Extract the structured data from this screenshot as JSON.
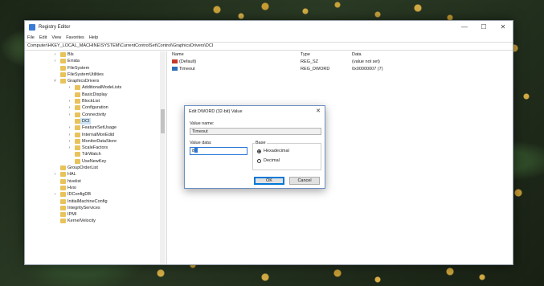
{
  "window": {
    "title": "Registry Editor",
    "controls": {
      "minimize": "—",
      "maximize": "☐",
      "close": "✕"
    },
    "menu": [
      "File",
      "Edit",
      "View",
      "Favorites",
      "Help"
    ],
    "address": "Computer\\HKEY_LOCAL_MACHINE\\SYSTEM\\CurrentControlSet\\Control\\GraphicsDrivers\\DCI"
  },
  "tree": [
    {
      "label": "Bls",
      "level": 0,
      "expander": ">"
    },
    {
      "label": "Errata",
      "level": 0,
      "expander": ">"
    },
    {
      "label": "FileSystem",
      "level": 0,
      "expander": ""
    },
    {
      "label": "FileSystemUtilities",
      "level": 0,
      "expander": ""
    },
    {
      "label": "GraphicsDrivers",
      "level": 0,
      "expander": "v"
    },
    {
      "label": "AdditionalModeLists",
      "level": 1,
      "expander": ">"
    },
    {
      "label": "BasicDisplay",
      "level": 1,
      "expander": ""
    },
    {
      "label": "BlockList",
      "level": 1,
      "expander": ">"
    },
    {
      "label": "Configuration",
      "level": 1,
      "expander": ">"
    },
    {
      "label": "Connectivity",
      "level": 1,
      "expander": ">"
    },
    {
      "label": "DCI",
      "level": 1,
      "expander": "",
      "selected": true
    },
    {
      "label": "FeatureSetUsage",
      "level": 1,
      "expander": ">"
    },
    {
      "label": "InternalMonEdid",
      "level": 1,
      "expander": ">"
    },
    {
      "label": "MonitorDataStore",
      "level": 1,
      "expander": ">"
    },
    {
      "label": "ScaleFactors",
      "level": 1,
      "expander": ">"
    },
    {
      "label": "TdrWatch",
      "level": 1,
      "expander": ""
    },
    {
      "label": "UseNewKey",
      "level": 1,
      "expander": ""
    },
    {
      "label": "GroupOrderList",
      "level": 0,
      "expander": ""
    },
    {
      "label": "HAL",
      "level": 0,
      "expander": ">"
    },
    {
      "label": "hivelist",
      "level": 0,
      "expander": ""
    },
    {
      "label": "Hvsi",
      "level": 0,
      "expander": ""
    },
    {
      "label": "IDConfigDB",
      "level": 0,
      "expander": ">"
    },
    {
      "label": "InitialMachineConfig",
      "level": 0,
      "expander": ""
    },
    {
      "label": "IntegrityServices",
      "level": 0,
      "expander": ""
    },
    {
      "label": "IPMI",
      "level": 0,
      "expander": ""
    },
    {
      "label": "KernelVelocity",
      "level": 0,
      "expander": ""
    }
  ],
  "values": {
    "headers": {
      "name": "Name",
      "type": "Type",
      "data": "Data"
    },
    "rows": [
      {
        "name": "(Default)",
        "type": "REG_SZ",
        "data": "(value not set)",
        "icon": "string-value-icon"
      },
      {
        "name": "Timeout",
        "type": "REG_DWORD",
        "data": "0x00000007 (7)",
        "icon": "binary-value-icon"
      }
    ]
  },
  "dialog": {
    "title": "Edit DWORD (32-bit) Value",
    "close": "✕",
    "value_name_label": "Value name:",
    "value_name": "Timeout",
    "value_data_label": "Value data:",
    "value_data": "8",
    "base_label": "Base",
    "base_options": [
      {
        "label": "Hexadecimal",
        "checked": true
      },
      {
        "label": "Decimal",
        "checked": false
      }
    ],
    "ok": "OK",
    "cancel": "Cancel"
  }
}
